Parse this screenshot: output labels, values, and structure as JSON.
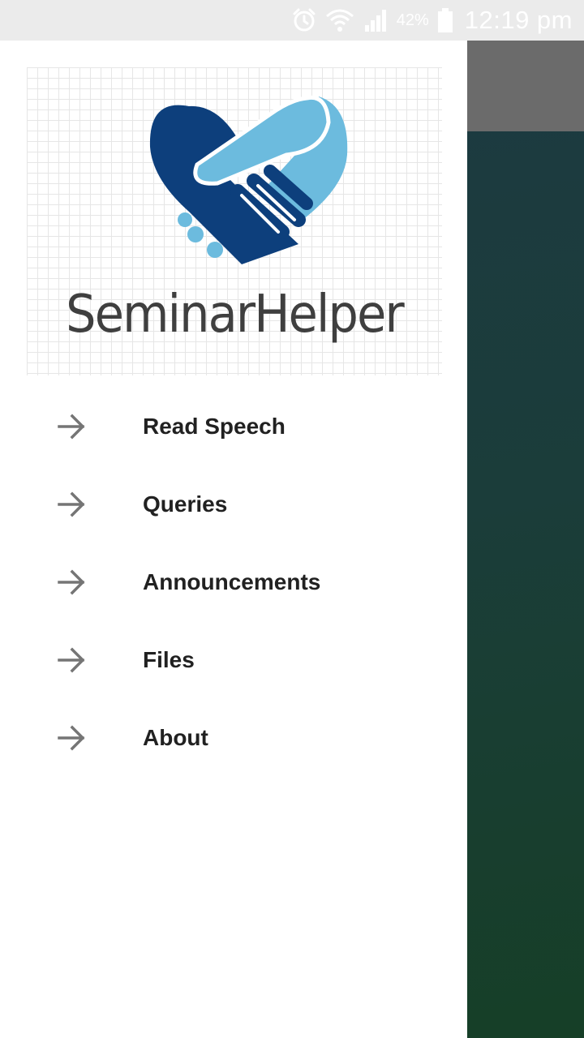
{
  "status_bar": {
    "icons": [
      "alarm-icon",
      "wifi-icon",
      "signal-icon",
      "battery-icon"
    ],
    "battery_percent": "42%",
    "time": "12:19 pm"
  },
  "drawer": {
    "logo": {
      "name": "SeminarHelper",
      "icon": "handshake-heart-icon"
    },
    "menu_icon": "arrow-right-icon",
    "items": [
      {
        "label": "Read Speech"
      },
      {
        "label": "Queries"
      },
      {
        "label": "Announcements"
      },
      {
        "label": "Files"
      },
      {
        "label": "About"
      }
    ]
  },
  "colors": {
    "logo_dark_blue": "#0d3f7c",
    "logo_light_blue": "#6cbbde",
    "menu_text": "#212121",
    "menu_icon": "#757575",
    "app_toolbar": "#6b6b6b",
    "status_bar_bg": "#ebebeb"
  }
}
